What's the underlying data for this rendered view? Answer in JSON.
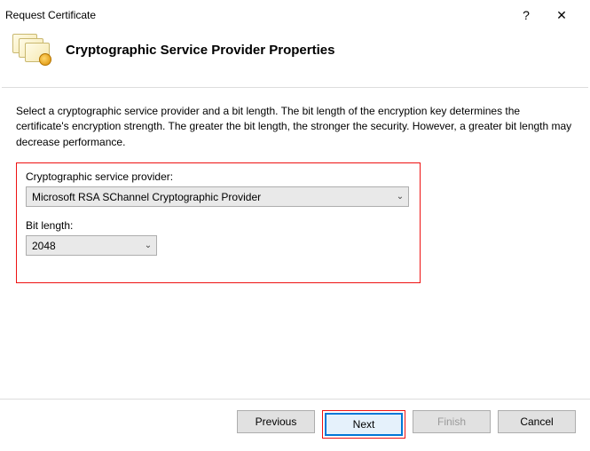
{
  "titlebar": {
    "title": "Request Certificate"
  },
  "header": {
    "title": "Cryptographic Service Provider Properties"
  },
  "description": "Select a cryptographic service provider and a bit length. The bit length of the encryption key determines the certificate's encryption strength. The greater the bit length, the stronger the security. However, a greater bit length may decrease performance.",
  "fields": {
    "provider": {
      "label": "Cryptographic service provider:",
      "value": "Microsoft RSA SChannel Cryptographic Provider"
    },
    "bitlength": {
      "label": "Bit length:",
      "value": "2048"
    }
  },
  "buttons": {
    "previous": "Previous",
    "next": "Next",
    "finish": "Finish",
    "cancel": "Cancel"
  }
}
